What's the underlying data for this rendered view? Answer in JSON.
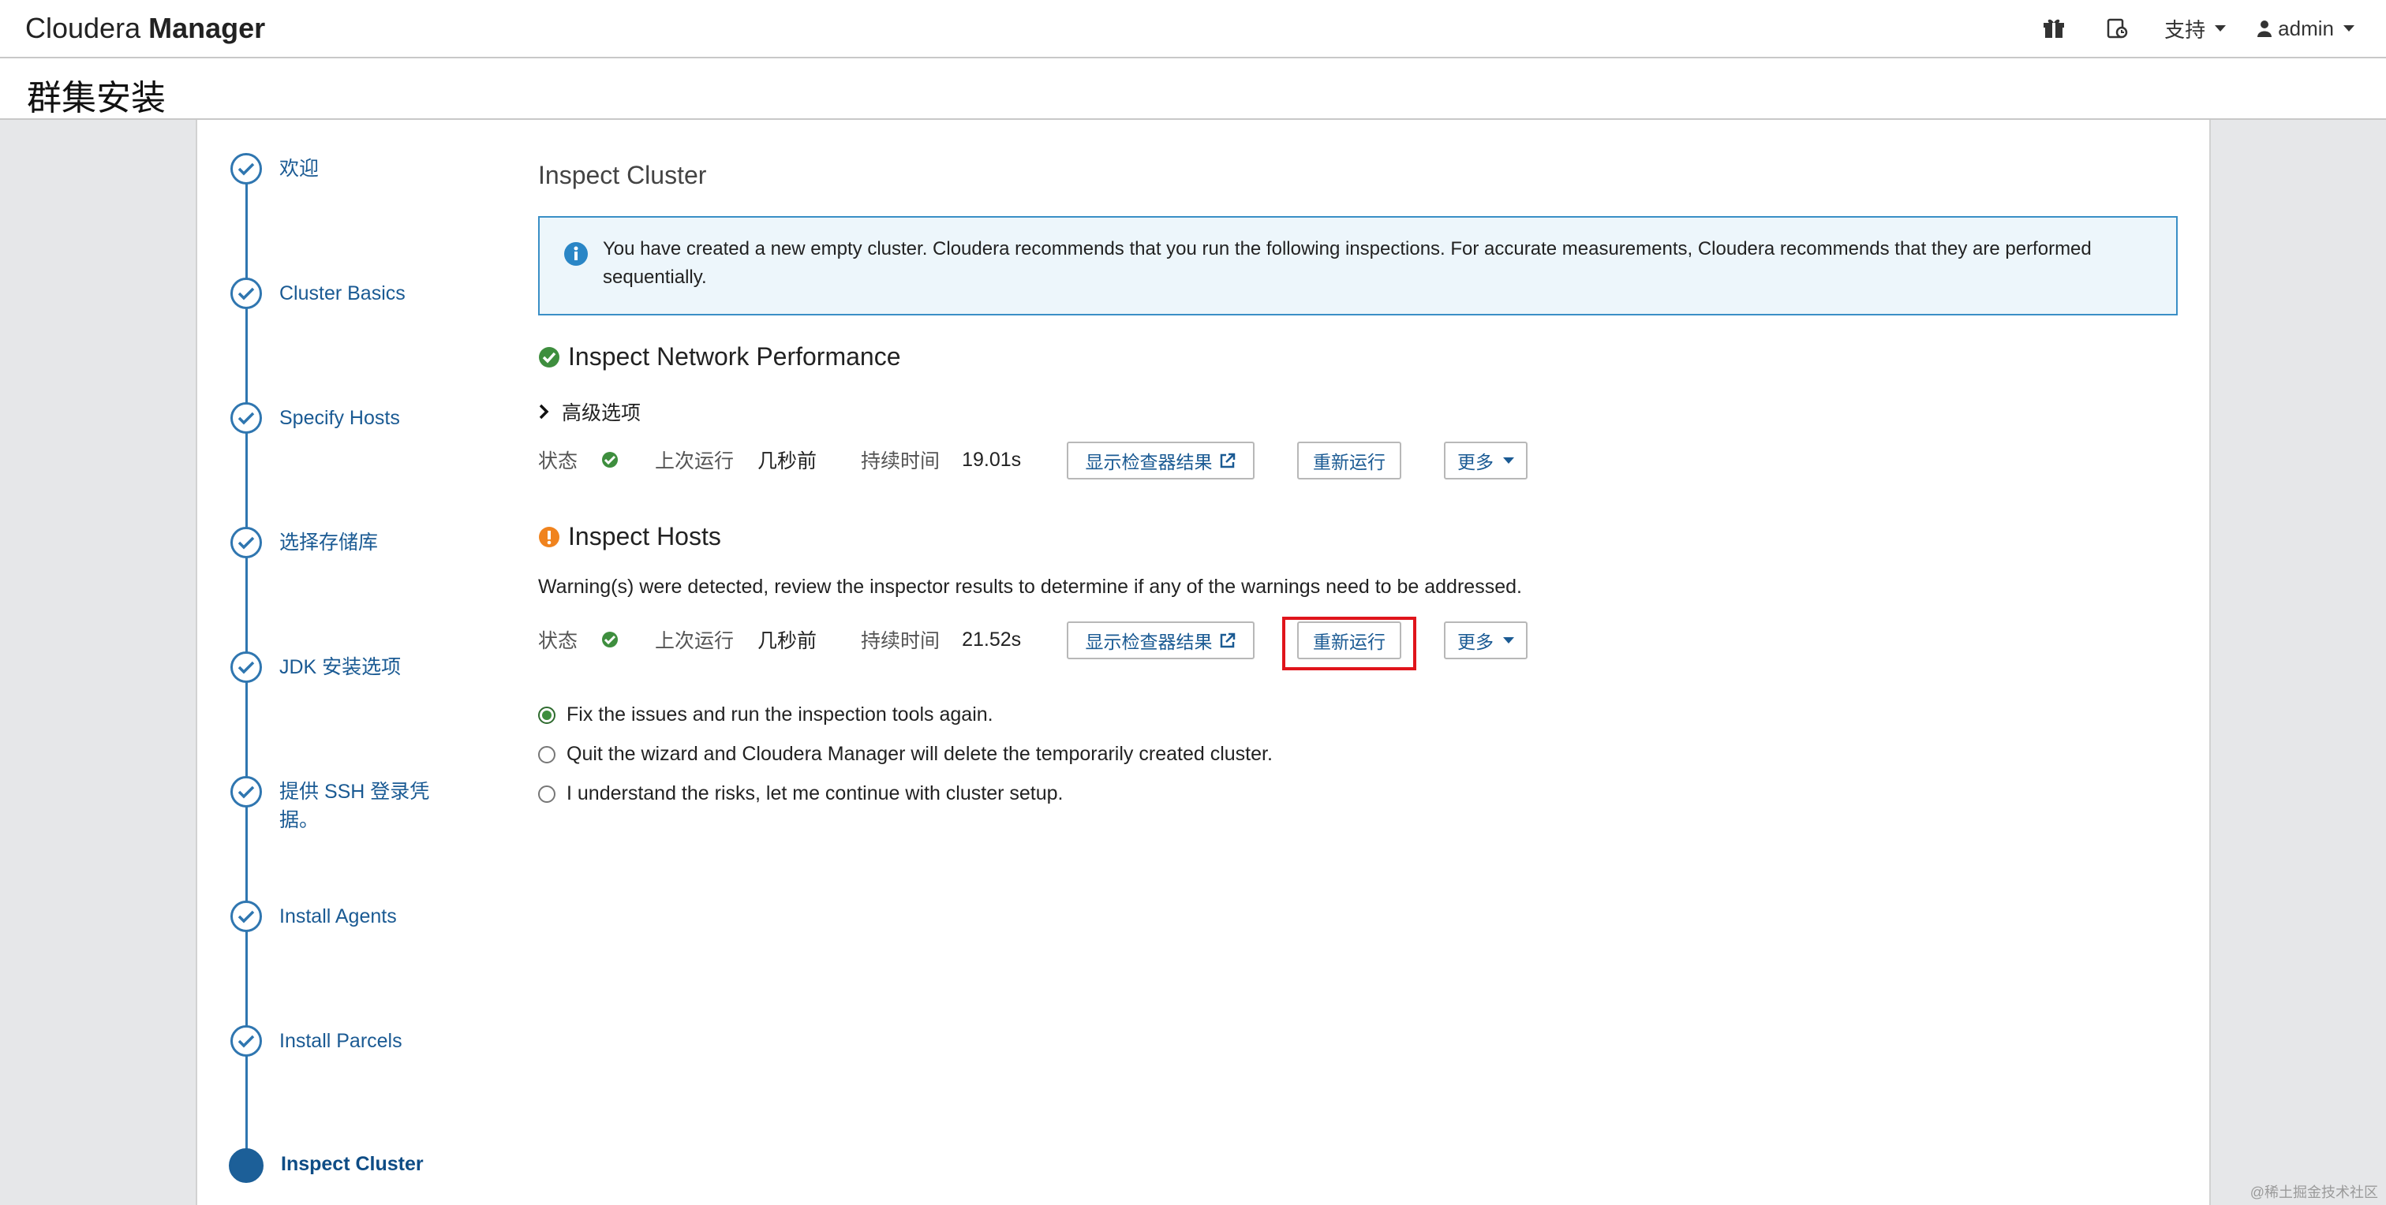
{
  "brand": {
    "part1": "Cloudera",
    "part2": "Manager"
  },
  "nav": {
    "support": "支持",
    "user": "admin"
  },
  "page": {
    "title": "群集安装"
  },
  "steps": [
    {
      "label": "欢迎"
    },
    {
      "label": "Cluster Basics"
    },
    {
      "label": "Specify Hosts"
    },
    {
      "label": "选择存储库"
    },
    {
      "label": "JDK 安装选项"
    },
    {
      "label": "提供 SSH 登录凭据。"
    },
    {
      "label": "Install Agents"
    },
    {
      "label": "Install Parcels"
    },
    {
      "label": "Inspect Cluster"
    }
  ],
  "main": {
    "title": "Inspect Cluster",
    "info": "You have created a new empty cluster. Cloudera recommends that you run the following inspections. For accurate measurements, Cloudera recommends that they are performed sequentially.",
    "network": {
      "title": "Inspect Network Performance",
      "advanced": "高级选项",
      "status_label": "状态",
      "last_run_label": "上次运行",
      "last_run": "几秒前",
      "duration_label": "持续时间",
      "duration": "19.01s",
      "show_results": "显示检查器结果",
      "rerun": "重新运行",
      "more": "更多"
    },
    "hosts": {
      "title": "Inspect Hosts",
      "warning": "Warning(s) were detected, review the inspector results to determine if any of the warnings need to be addressed.",
      "status_label": "状态",
      "last_run_label": "上次运行",
      "last_run": "几秒前",
      "duration_label": "持续时间",
      "duration": "21.52s",
      "show_results": "显示检查器结果",
      "rerun": "重新运行",
      "more": "更多"
    },
    "options": [
      {
        "label": "Fix the issues and run the inspection tools again.",
        "checked": true
      },
      {
        "label": "Quit the wizard and Cloudera Manager will delete the temporarily created cluster.",
        "checked": false
      },
      {
        "label": "I understand the risks, let me continue with cluster setup.",
        "checked": false
      }
    ]
  },
  "watermark": "@稀土掘金技术社区",
  "colors": {
    "primary": "#1a5a93",
    "success": "#3e8e3e",
    "warning": "#f0831e",
    "highlight": "#e0141b",
    "info_border": "#3a8fc6"
  }
}
